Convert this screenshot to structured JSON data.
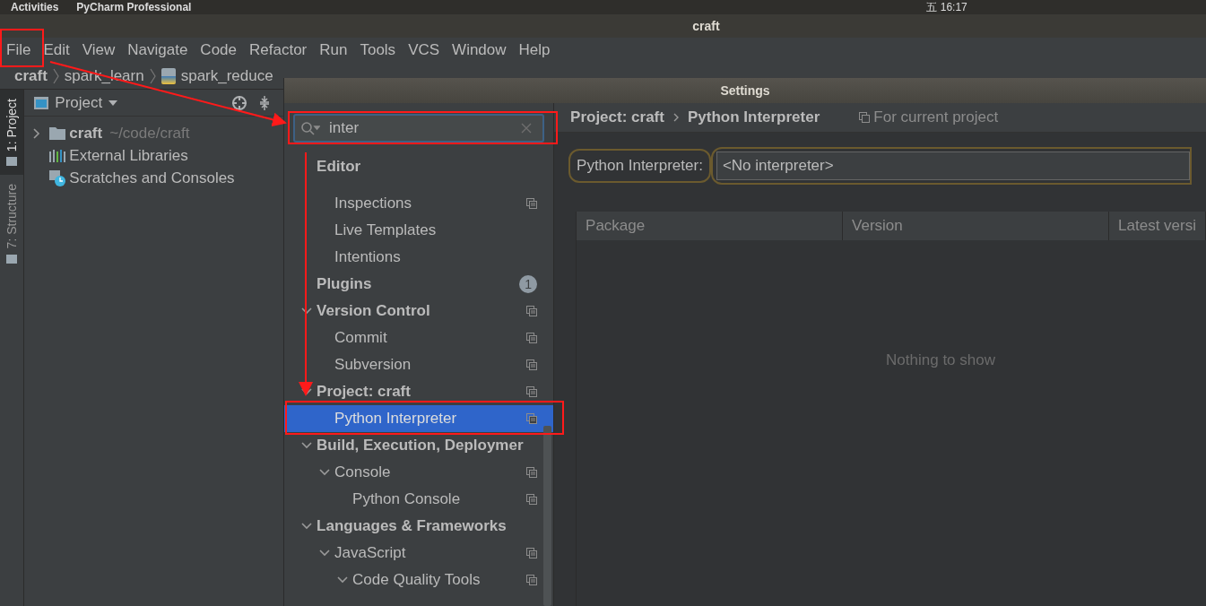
{
  "top_bar": {
    "activities": "Activities",
    "app": "PyCharm Professional",
    "clock": "五 16:17"
  },
  "window": {
    "title": "craft"
  },
  "menu": [
    "File",
    "Edit",
    "View",
    "Navigate",
    "Code",
    "Refactor",
    "Run",
    "Tools",
    "VCS",
    "Window",
    "Help"
  ],
  "breadcrumb": [
    "craft",
    "spark_learn",
    "spark_reduce"
  ],
  "tool_stripe": [
    {
      "label": "1: Project",
      "selected": true
    },
    {
      "label": "7: Structure",
      "selected": false
    }
  ],
  "project_panel": {
    "title": "Project",
    "tree": [
      {
        "kind": "folder",
        "name": "craft",
        "path": "~/code/craft",
        "expanded": false
      },
      {
        "kind": "libraries",
        "name": "External Libraries"
      },
      {
        "kind": "scratches",
        "name": "Scratches and Consoles"
      }
    ]
  },
  "settings": {
    "title": "Settings",
    "search": {
      "value": "inter"
    },
    "tree": [
      {
        "label": "Editor",
        "children": [
          {
            "label": "Inspections",
            "scope": true,
            "selected": false
          },
          {
            "label": "Live Templates",
            "selected": false
          },
          {
            "label": "Intentions",
            "selected": false
          }
        ]
      },
      {
        "label": "Plugins",
        "badge": "1",
        "selected": false
      },
      {
        "label": "Version Control",
        "expanded": true,
        "scope": true,
        "selected": false,
        "children": [
          {
            "label": "Commit",
            "scope": true,
            "selected": false
          },
          {
            "label": "Subversion",
            "scope": true,
            "selected": false
          }
        ]
      },
      {
        "label": "Project: craft",
        "expanded": true,
        "scope": true,
        "selected": false,
        "children": [
          {
            "label": "Python Interpreter",
            "scope": true,
            "selected": true
          }
        ]
      },
      {
        "label": "Build, Execution, Deploymer",
        "expanded": true,
        "selected": false,
        "children": [
          {
            "label": "Console",
            "expanded": true,
            "scope": true,
            "selected": false,
            "children": [
              {
                "label": "Python Console",
                "scope": true,
                "selected": false
              }
            ]
          }
        ]
      },
      {
        "label": "Languages & Frameworks",
        "expanded": true,
        "selected": false,
        "children": [
          {
            "label": "JavaScript",
            "expanded": true,
            "scope": true,
            "selected": false,
            "children": [
              {
                "label": "Code Quality Tools",
                "expanded": true,
                "scope": true,
                "selected": false
              }
            ]
          }
        ]
      }
    ],
    "breadcrumb": [
      "Project: craft",
      "Python Interpreter"
    ],
    "scope_note": "For current project",
    "interpreter_label": "Python Interpreter:",
    "interpreter_value": "<No interpreter>",
    "table": {
      "columns": [
        "Package",
        "Version",
        "Latest versi"
      ],
      "empty_text": "Nothing to show"
    }
  }
}
